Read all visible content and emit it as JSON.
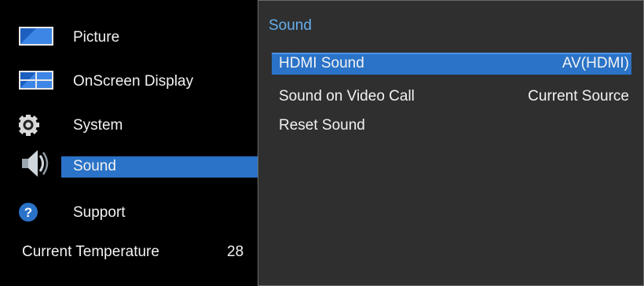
{
  "sidebar": {
    "items": [
      {
        "label": "Picture",
        "icon": "picture-icon"
      },
      {
        "label": "OnScreen Display",
        "icon": "onscreen-display-icon"
      },
      {
        "label": "System",
        "icon": "gear-icon"
      },
      {
        "label": "Sound",
        "icon": "speaker-icon",
        "selected": true
      },
      {
        "label": "Support",
        "icon": "help-icon"
      }
    ],
    "temperature": {
      "label": "Current Temperature",
      "value": "28"
    }
  },
  "panel": {
    "title": "Sound",
    "items": [
      {
        "label": "HDMI Sound",
        "value": "AV(HDMI)",
        "selected": true
      },
      {
        "label": "Sound on Video Call",
        "value": "Current Source"
      },
      {
        "label": "Reset Sound",
        "value": ""
      }
    ]
  },
  "colors": {
    "accent": "#2a73c8",
    "title": "#65b0ee",
    "panel_bg": "#2f2f2f",
    "sidebar_bg": "#000000"
  }
}
